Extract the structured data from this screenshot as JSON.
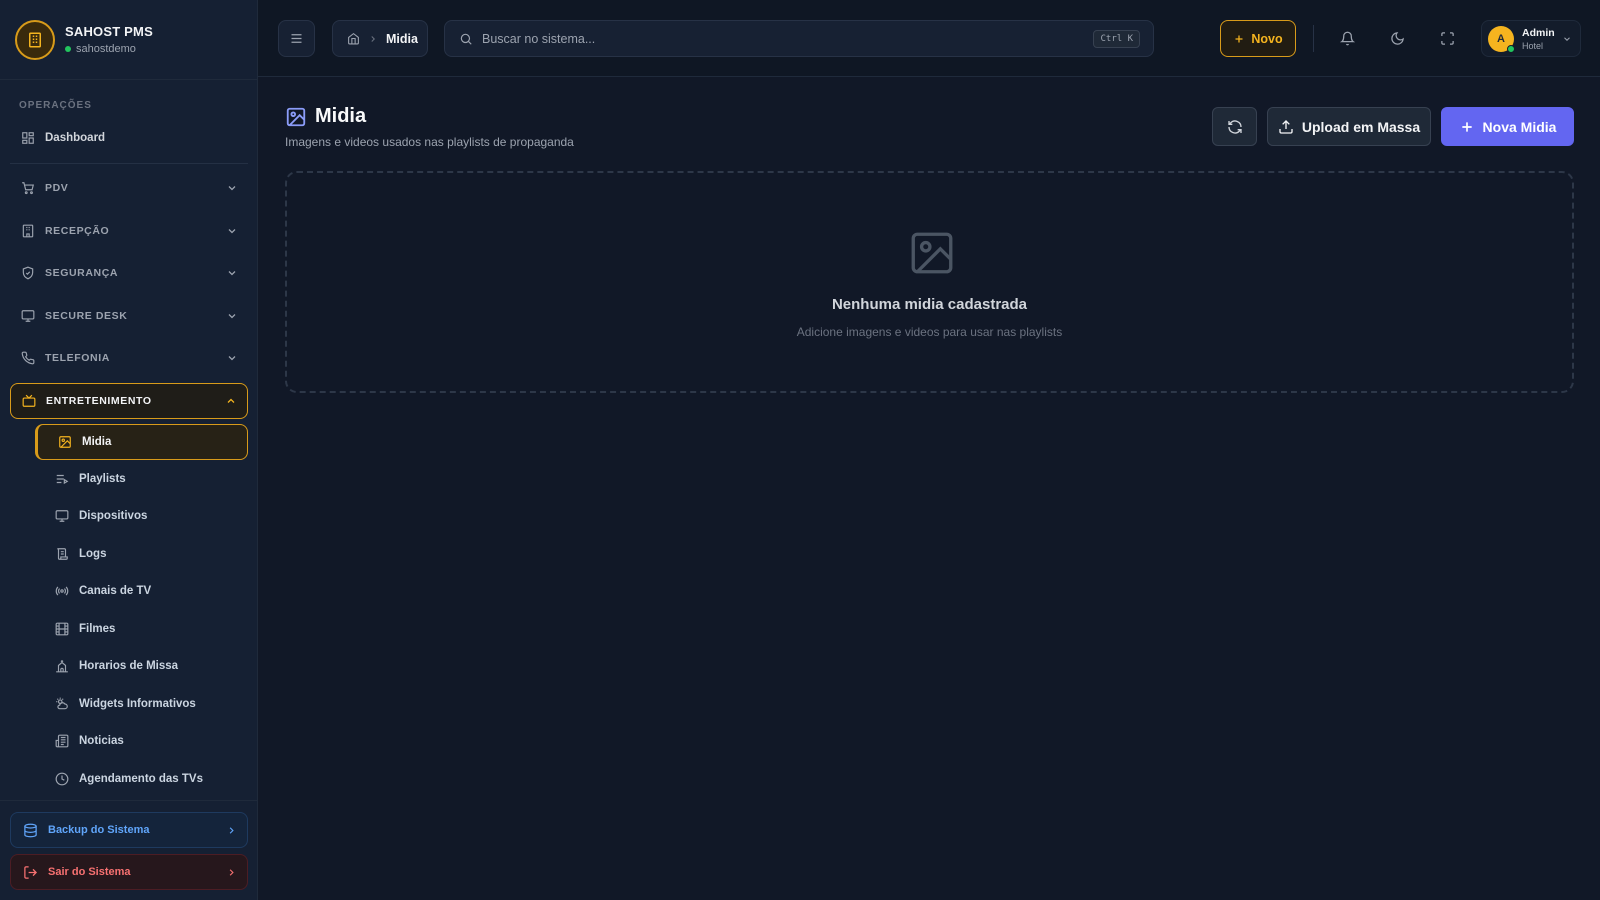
{
  "brand": {
    "name": "SAHOST PMS",
    "tenant": "sahostdemo"
  },
  "sidebar": {
    "section_label": "OPERAÇÕES",
    "dashboard": "Dashboard",
    "groups": [
      {
        "label": "PDV",
        "icon": "cart-icon"
      },
      {
        "label": "RECEPÇÃO",
        "icon": "building-icon"
      },
      {
        "label": "SEGURANÇA",
        "icon": "shield-icon"
      },
      {
        "label": "SECURE DESK",
        "icon": "monitor-icon"
      },
      {
        "label": "TELEFONIA",
        "icon": "phone-icon"
      },
      {
        "label": "ENTRETENIMENTO",
        "icon": "tv-icon",
        "expanded": true
      }
    ],
    "entertainment_items": [
      {
        "label": "Midia",
        "icon": "image-icon",
        "active": true
      },
      {
        "label": "Playlists",
        "icon": "playlist-icon"
      },
      {
        "label": "Dispositivos",
        "icon": "monitor-icon"
      },
      {
        "label": "Logs",
        "icon": "scroll-icon"
      },
      {
        "label": "Canais de TV",
        "icon": "radio-icon"
      },
      {
        "label": "Filmes",
        "icon": "film-icon"
      },
      {
        "label": "Horarios de Missa",
        "icon": "church-icon"
      },
      {
        "label": "Widgets Informativos",
        "icon": "weather-icon"
      },
      {
        "label": "Noticias",
        "icon": "newspaper-icon"
      },
      {
        "label": "Agendamento das TVs",
        "icon": "clock-icon"
      }
    ],
    "backup_label": "Backup do Sistema",
    "exit_label": "Sair do Sistema"
  },
  "header": {
    "breadcrumb_current": "Midia",
    "search_placeholder": "Buscar no sistema...",
    "search_shortcut": "Ctrl K",
    "new_label": "Novo",
    "user": {
      "initial": "A",
      "name": "Admin",
      "role": "Hotel"
    }
  },
  "main": {
    "title": "Midia",
    "subtitle": "Imagens e videos usados nas playlists de propaganda",
    "upload_label": "Upload em Massa",
    "new_media_label": "Nova Midia",
    "empty_title": "Nenhuma midia cadastrada",
    "empty_subtitle": "Adicione imagens e videos para usar nas playlists"
  },
  "colors": {
    "accent": "#f5b41f",
    "primary": "#6366f1",
    "background": "#111827",
    "sidebar": "#152033"
  }
}
